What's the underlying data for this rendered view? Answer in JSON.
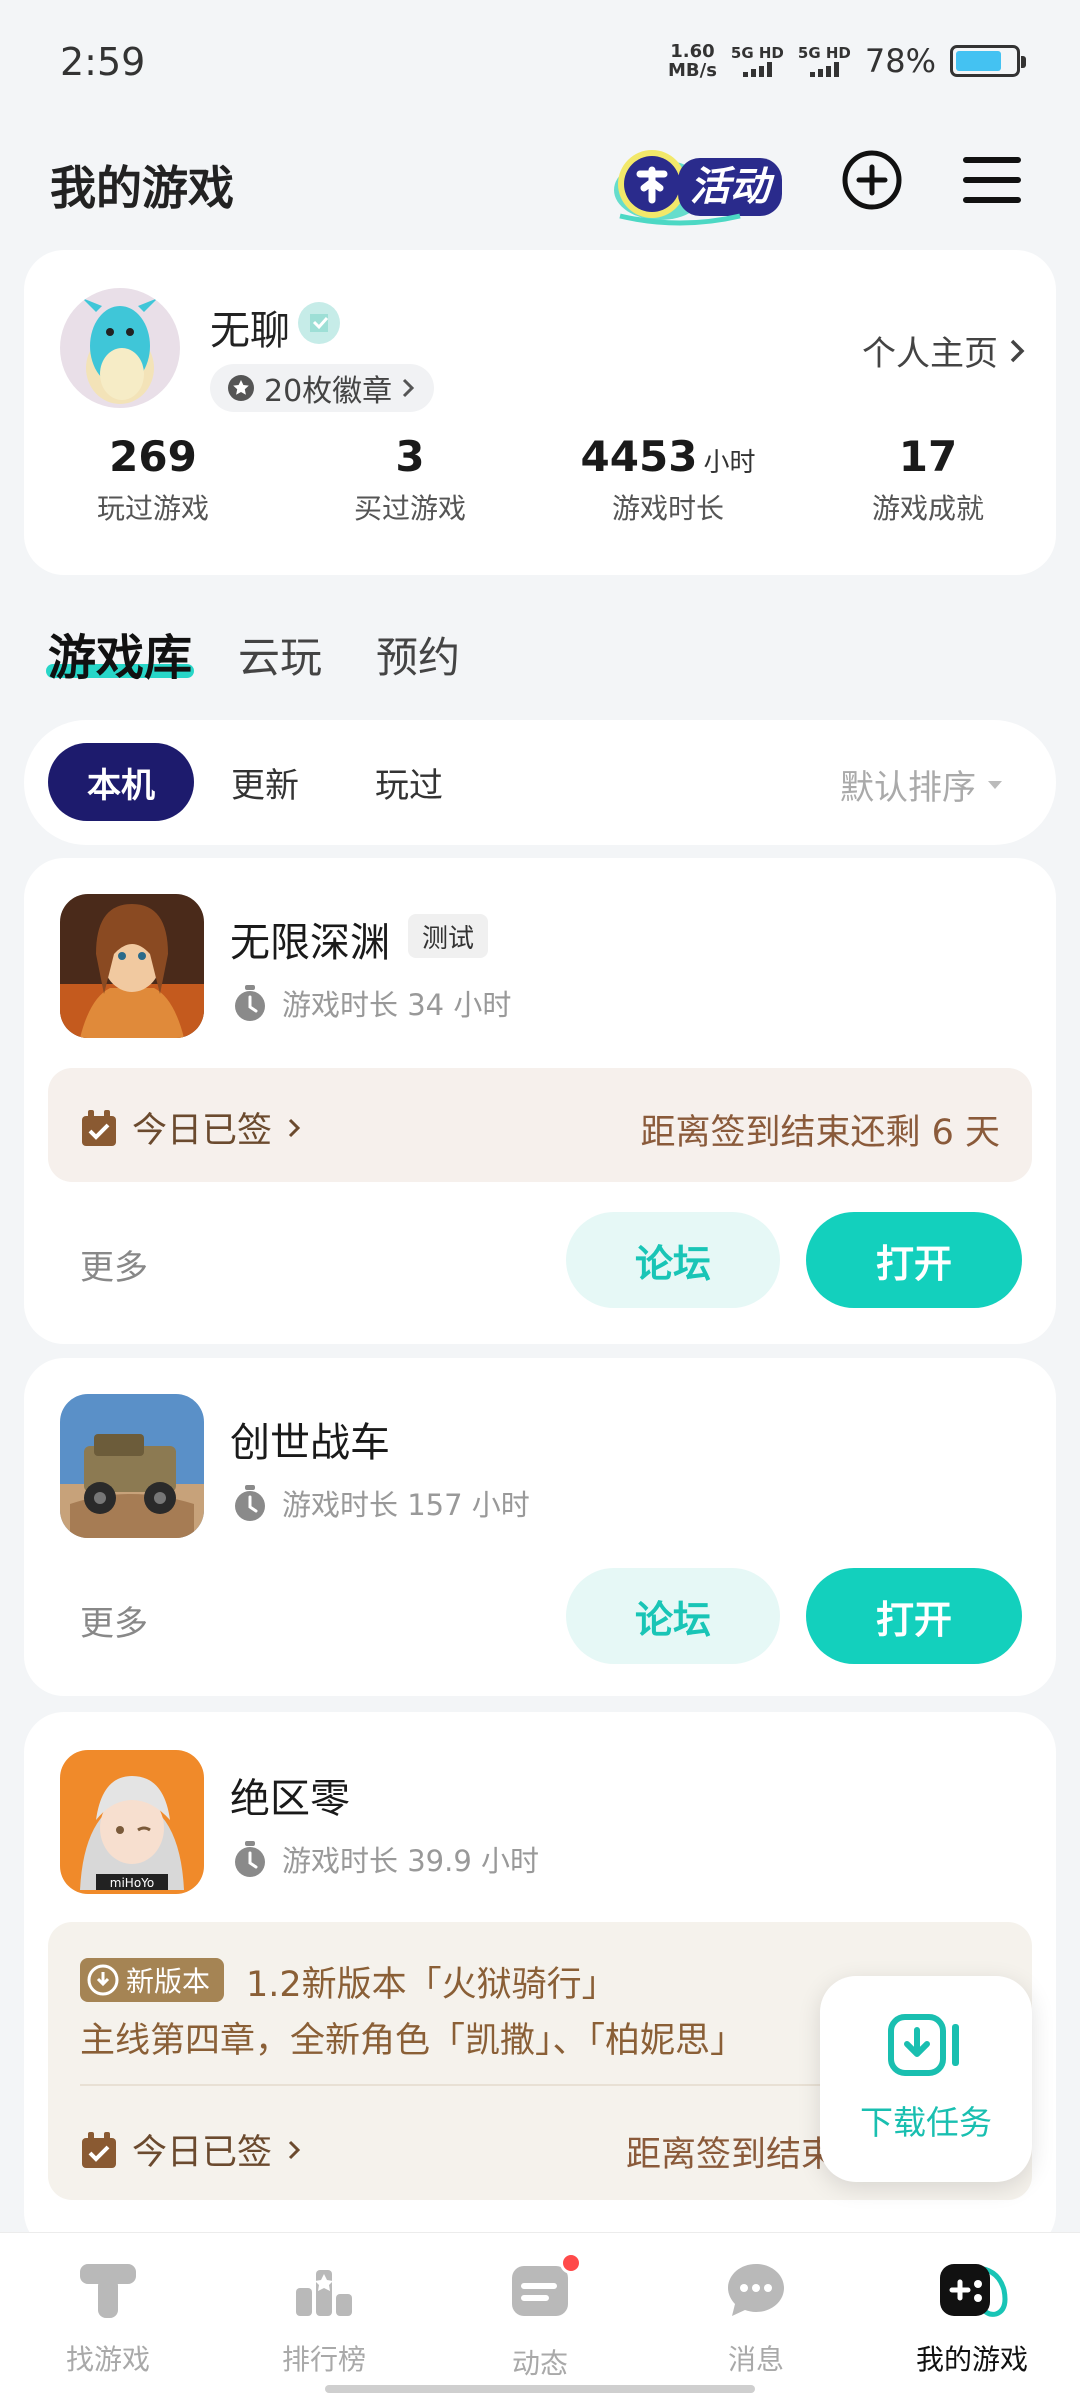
{
  "status_bar": {
    "time": "2:59",
    "net_speed_value": "1.60",
    "net_speed_unit": "MB/s",
    "sim1": "5G HD",
    "sim2": "5G HD",
    "battery_percent": "78%",
    "battery_level": 0.78,
    "battery_color": "#44c2f2"
  },
  "header": {
    "title": "我的游戏",
    "activity_label": "活动",
    "plus_icon": "plus-circle-icon",
    "menu_icon": "hamburger-menu-icon"
  },
  "profile": {
    "username": "无聊",
    "badge_text": "20枚徽章",
    "home_link": "个人主页",
    "stats": [
      {
        "value": "269",
        "unit": "",
        "label": "玩过游戏"
      },
      {
        "value": "3",
        "unit": "",
        "label": "买过游戏"
      },
      {
        "value": "4453",
        "unit": "小时",
        "label": "游戏时长"
      },
      {
        "value": "17",
        "unit": "",
        "label": "游戏成就"
      }
    ]
  },
  "tabs": [
    "游戏库",
    "云玩",
    "预约"
  ],
  "filters": {
    "chips": [
      "本机",
      "更新",
      "玩过"
    ],
    "sort": "默认排序"
  },
  "games": [
    {
      "name": "无限深渊",
      "tag": "测试",
      "playtime": "游戏时长 34 小时",
      "sign_left": "今日已签",
      "sign_right": "距离签到结束还剩 6 天",
      "more": "更多",
      "forum": "论坛",
      "open": "打开"
    },
    {
      "name": "创世战车",
      "playtime": "游戏时长 157 小时",
      "more": "更多",
      "forum": "论坛",
      "open": "打开"
    },
    {
      "name": "绝区零",
      "playtime": "游戏时长 39.9 小时",
      "news_tag": "新版本",
      "news_title": "1.2新版本「火狱骑行」",
      "news_desc": "主线第四章，全新角色「凯撒」、「柏妮思」",
      "sign_left": "今日已签",
      "sign_right": "距离签到结束",
      "icon_caption": "miHoYo"
    }
  ],
  "floating": {
    "label": "下载任务"
  },
  "bottom_nav": [
    {
      "label": "找游戏",
      "icon": "find-game-icon"
    },
    {
      "label": "排行榜",
      "icon": "ranking-icon"
    },
    {
      "label": "动态",
      "icon": "feed-icon"
    },
    {
      "label": "消息",
      "icon": "message-icon"
    },
    {
      "label": "我的游戏",
      "icon": "gamepad-icon"
    }
  ],
  "colors": {
    "accent": "#13d0bd",
    "chip_active": "#1d1b6d",
    "sign_bg": "#f6f0ec"
  }
}
